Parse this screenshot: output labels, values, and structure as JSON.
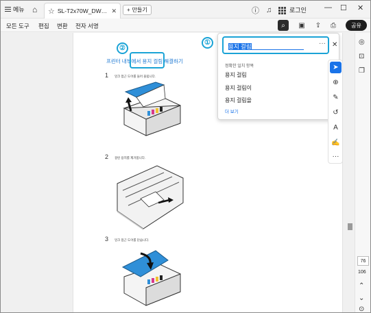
{
  "titlebar": {
    "menu_label": "메뉴",
    "tab_title": "SL-T2x70W_DW_Seri...",
    "new_tab_label": "만들기",
    "login_label": "로그인"
  },
  "toolbar": {
    "items": [
      "모든 도구",
      "편집",
      "변환",
      "전자 서명"
    ],
    "share_label": "공유"
  },
  "search_panel": {
    "query": "용지 걸림",
    "section_title": "정확한 일치 항목",
    "results": [
      "용지 걸림",
      "용지 걸림이",
      "용지 걸림을"
    ],
    "more_label": "더 보기"
  },
  "document": {
    "heading": "프린터 내부에서 용지 걸림 해결하기",
    "steps": [
      {
        "num": "1",
        "text": "잉크 접근 도어를 들어 올립니다."
      },
      {
        "num": "2",
        "text": "걸린 용지를 제거합니다."
      },
      {
        "num": "3",
        "text": "잉크 접근 도어를 닫습니다."
      }
    ]
  },
  "annotations": {
    "badge_1": "①",
    "badge_2": "②",
    "accent_color": "#1aa3d6"
  },
  "sidebar": {
    "current_page": "76",
    "total_pages": "106"
  },
  "icons": [
    "home-icon",
    "star-icon",
    "help-icon",
    "bell-icon",
    "apps-icon",
    "search-icon",
    "save-icon",
    "upload-icon",
    "print-icon",
    "select-tool-icon",
    "comment-tool-icon",
    "pen-tool-icon",
    "lasso-tool-icon",
    "text-tool-icon",
    "signature-tool-icon",
    "more-tools-icon"
  ]
}
